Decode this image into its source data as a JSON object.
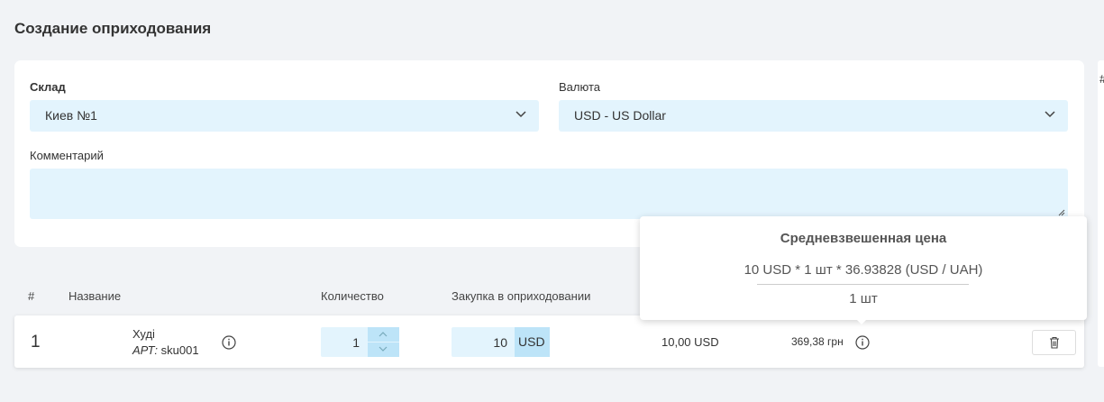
{
  "page": {
    "title": "Создание оприходования"
  },
  "form": {
    "warehouse": {
      "label": "Склад",
      "value": "Киев №1"
    },
    "currency": {
      "label": "Валюта",
      "value": "USD - US Dollar"
    },
    "comment": {
      "label": "Комментарий",
      "value": ""
    }
  },
  "table": {
    "headers": {
      "num": "#",
      "name": "Название",
      "qty": "Количество",
      "purchase": "Закупка в оприходовании"
    },
    "rows": [
      {
        "num": "1",
        "name": "Худі",
        "sku_prefix": "АРТ:",
        "sku": "sku001",
        "qty": "1",
        "price": "10",
        "price_currency": "USD",
        "sum_usd": "10,00 USD",
        "sum_uah": "369,38 грн"
      }
    ]
  },
  "tooltip": {
    "title": "Средневзвешенная цена",
    "formula": "10 USD * 1 шт * 36.93828 (USD / UAH)",
    "denominator": "1 шт"
  },
  "edge": {
    "mark": "#"
  },
  "icons": [
    "chevron-down-icon",
    "info-icon",
    "chevron-up-icon",
    "trash-icon",
    "resize-grip-icon"
  ]
}
